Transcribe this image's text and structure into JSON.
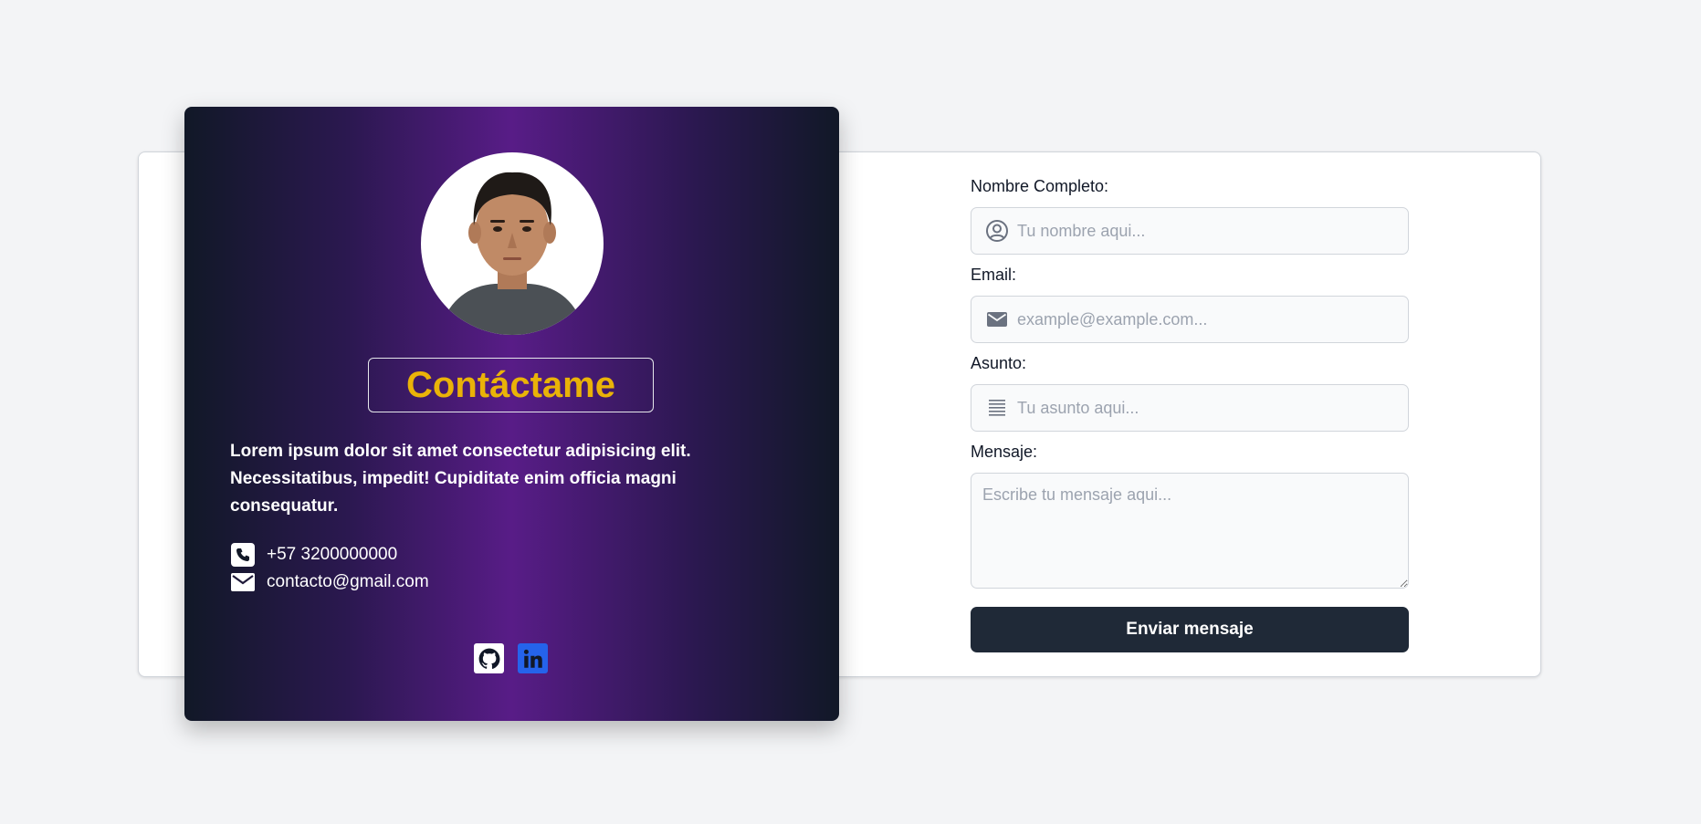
{
  "profile": {
    "title": "Contáctame",
    "intro": "Lorem ipsum dolor sit amet consectetur adipisicing elit. Necessitatibus, impedit! Cupiditate enim officia magni consequatur.",
    "phone": "+57 3200000000",
    "email": "contacto@gmail.com",
    "avatar_alt": "profile-photo",
    "social": [
      {
        "name": "github",
        "icon": "github-icon"
      },
      {
        "name": "linkedin",
        "icon": "linkedin-icon"
      }
    ]
  },
  "form": {
    "name_label": "Nombre Completo:",
    "name_placeholder": "Tu nombre aqui...",
    "email_label": "Email:",
    "email_placeholder": "example@example.com...",
    "subject_label": "Asunto:",
    "subject_placeholder": "Tu asunto aqui...",
    "message_label": "Mensaje:",
    "message_placeholder": "Escribe tu mensaje aqui...",
    "submit_label": "Enviar mensaje"
  },
  "colors": {
    "accent": "#eab308",
    "gradient_mid": "#581c87",
    "gradient_edge": "#111827",
    "button": "#1f2937",
    "linkedin": "#2563eb"
  }
}
